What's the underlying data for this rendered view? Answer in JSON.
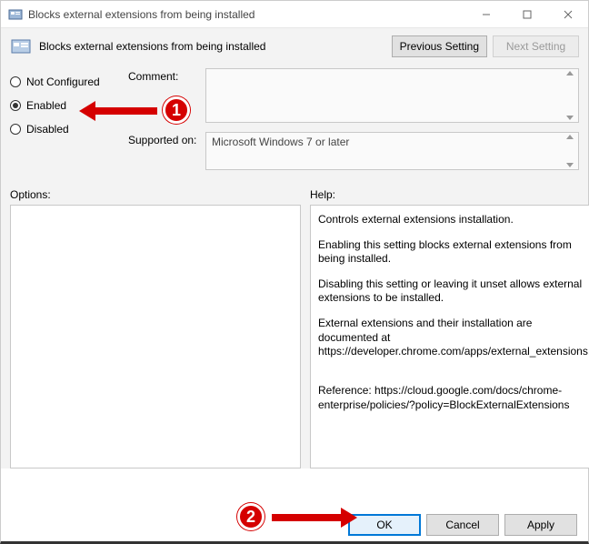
{
  "window": {
    "title": "Blocks external extensions from being installed"
  },
  "header": {
    "title": "Blocks external extensions from being installed",
    "prev": "Previous Setting",
    "next": "Next Setting"
  },
  "radios": {
    "not_configured": "Not Configured",
    "enabled": "Enabled",
    "disabled": "Disabled",
    "selected": "enabled"
  },
  "labels": {
    "comment": "Comment:",
    "supported": "Supported on:",
    "options": "Options:",
    "help": "Help:"
  },
  "supported": "Microsoft Windows 7 or later",
  "help": {
    "p1": "Controls external extensions installation.",
    "p2": "Enabling this setting blocks external extensions from being installed.",
    "p3": "Disabling this setting or leaving it unset allows external extensions to be installed.",
    "p4": "External extensions and their installation are documented at https://developer.chrome.com/apps/external_extensions.",
    "p5": "Reference: https://cloud.google.com/docs/chrome-enterprise/policies/?policy=BlockExternalExtensions"
  },
  "footer": {
    "ok": "OK",
    "cancel": "Cancel",
    "apply": "Apply"
  },
  "annotations": {
    "c1": "1",
    "c2": "2"
  }
}
